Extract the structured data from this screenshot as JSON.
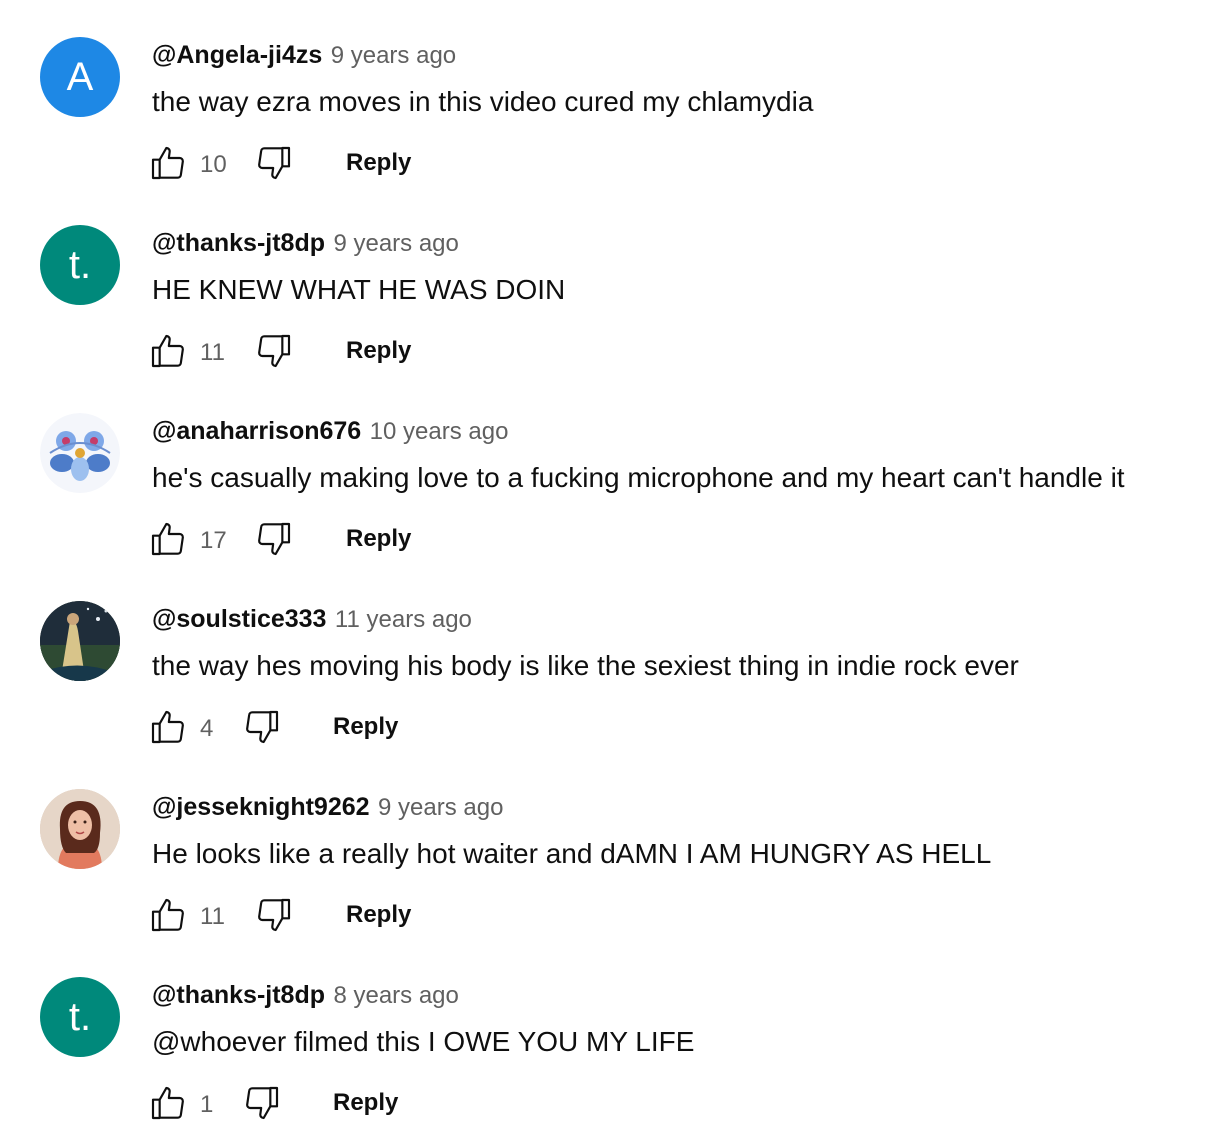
{
  "comments": [
    {
      "author": "@Angela-ji4zs",
      "time": "9 years ago",
      "text": "the way ezra moves in this video cured my chlamydia",
      "likes": "10",
      "reply": "Reply",
      "avatar_letter": "A",
      "avatar_color": "#1e88e5"
    },
    {
      "author": "@thanks-jt8dp",
      "time": "9 years ago",
      "text": "HE KNEW WHAT HE WAS DOIN",
      "likes": "11",
      "reply": "Reply",
      "avatar_letter": "t.",
      "avatar_color": "#00897b"
    },
    {
      "author": "@anaharrison676",
      "time": "10 years ago",
      "text": "he's casually making love to a fucking microphone and my heart can't handle it",
      "likes": "17",
      "reply": "Reply"
    },
    {
      "author": "@soulstice333",
      "time": "11 years ago",
      "text": "the way hes moving his body is like the sexiest thing in indie rock ever",
      "likes": "4",
      "reply": "Reply"
    },
    {
      "author": "@jesseknight9262",
      "time": "9 years ago",
      "text": "He looks like a really hot waiter and dAMN I AM HUNGRY AS HELL",
      "likes": "11",
      "reply": "Reply"
    },
    {
      "author": "@thanks-jt8dp",
      "time": "8 years ago",
      "text": "@whoever filmed this I OWE YOU MY LIFE",
      "likes": "1",
      "reply": "Reply",
      "avatar_letter": "t.",
      "avatar_color": "#00897b"
    }
  ]
}
